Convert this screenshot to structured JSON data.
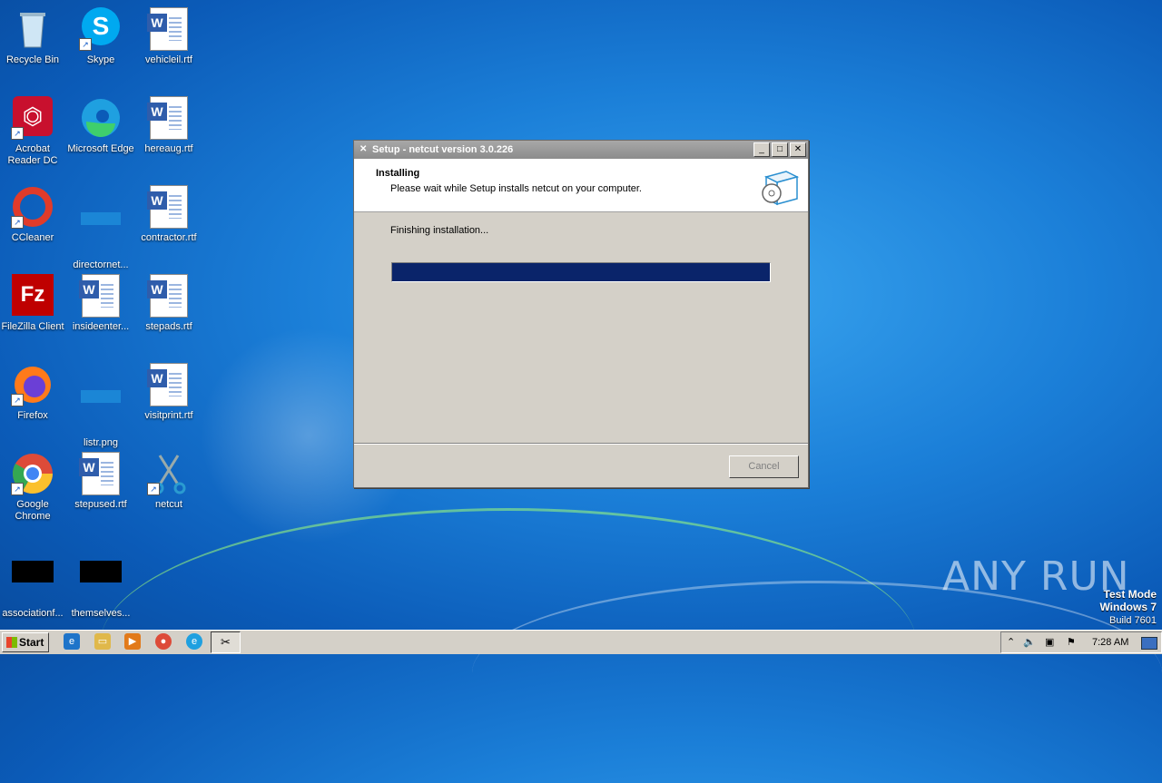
{
  "desktop": {
    "icons": [
      {
        "label": "Recycle Bin",
        "icon": "recycle-bin-icon"
      },
      {
        "label": "Skype",
        "icon": "skype-icon"
      },
      {
        "label": "vehicleil.rtf",
        "icon": "word-document-icon"
      },
      {
        "label": "Acrobat Reader DC",
        "icon": "acrobat-icon"
      },
      {
        "label": "Microsoft Edge",
        "icon": "edge-icon"
      },
      {
        "label": "hereaug.rtf",
        "icon": "word-document-icon"
      },
      {
        "label": "CCleaner",
        "icon": "ccleaner-icon"
      },
      {
        "label": "directornet...",
        "icon": "blank-file-icon"
      },
      {
        "label": "contractor.rtf",
        "icon": "word-document-icon"
      },
      {
        "label": "FileZilla Client",
        "icon": "filezilla-icon"
      },
      {
        "label": "insideenter...",
        "icon": "word-document-icon"
      },
      {
        "label": "stepads.rtf",
        "icon": "word-document-icon"
      },
      {
        "label": "Firefox",
        "icon": "firefox-icon"
      },
      {
        "label": "listr.png",
        "icon": "image-file-icon"
      },
      {
        "label": "visitprint.rtf",
        "icon": "word-document-icon"
      },
      {
        "label": "Google Chrome",
        "icon": "chrome-icon"
      },
      {
        "label": "stepused.rtf",
        "icon": "word-document-icon"
      },
      {
        "label": "netcut",
        "icon": "scissors-icon"
      },
      {
        "label": "associationf...",
        "icon": "black-file-icon"
      },
      {
        "label": "themselves...",
        "icon": "black-file-icon"
      }
    ]
  },
  "dialog": {
    "title": "Setup - netcut version 3.0.226",
    "heading": "Installing",
    "subheading": "Please wait while Setup installs netcut on your computer.",
    "status": "Finishing installation...",
    "progress": 1.0,
    "cancel_label": "Cancel",
    "progress_color": "#0a246a"
  },
  "taskbar": {
    "start_label": "Start",
    "clock": "7:28 AM",
    "pinned": [
      "internet-explorer-icon",
      "explorer-icon",
      "media-player-icon",
      "chrome-icon",
      "edge-icon",
      "netcut-icon"
    ]
  },
  "watermark": {
    "brand": "ANY RUN",
    "line1": "Test Mode",
    "line2": "Windows 7",
    "line3": "Build 7601"
  }
}
